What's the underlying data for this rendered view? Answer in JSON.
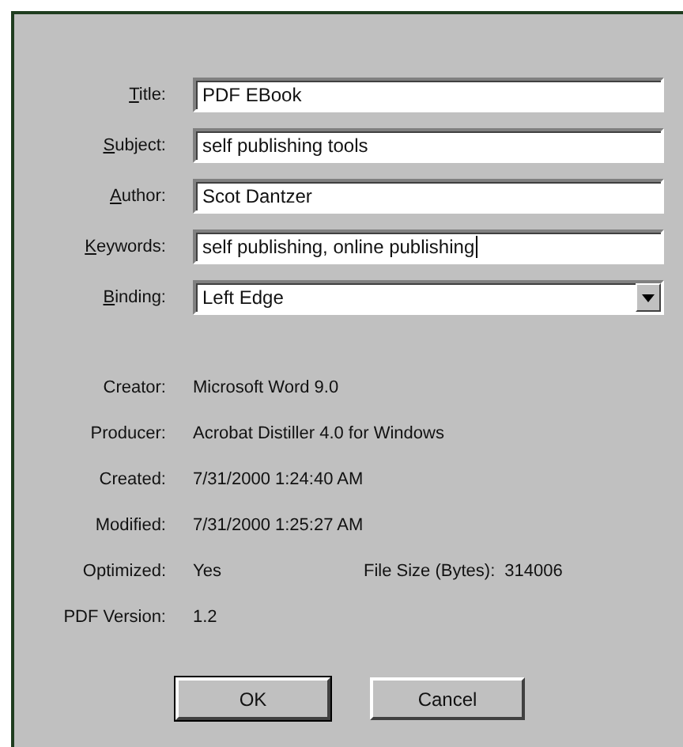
{
  "fields": [
    {
      "label": "Title:",
      "value": "PDF EBook",
      "kind": "text",
      "focused": false
    },
    {
      "label": "Subject:",
      "value": "self publishing tools",
      "kind": "text",
      "focused": false
    },
    {
      "label": "Author:",
      "value": "Scot Dantzer",
      "kind": "text",
      "focused": false
    },
    {
      "label": "Keywords:",
      "value": "self publishing, online publishing",
      "kind": "text",
      "focused": true
    },
    {
      "label": "Binding:",
      "value": "Left Edge",
      "kind": "dropdown",
      "focused": false
    }
  ],
  "info": [
    {
      "label": "Creator:",
      "value": "Microsoft Word 9.0"
    },
    {
      "label": "Producer:",
      "value": "Acrobat Distiller 4.0 for Windows"
    },
    {
      "label": "Created:",
      "value": "7/31/2000 1:24:40 AM"
    },
    {
      "label": "Modified:",
      "value": "7/31/2000 1:25:27 AM"
    },
    {
      "label": "Optimized:",
      "value": "Yes",
      "extra_label": "File Size (Bytes):",
      "extra_value": "314006"
    },
    {
      "label": "PDF Version:",
      "value": "1.2"
    }
  ],
  "buttons": [
    {
      "label": "OK",
      "default": true
    },
    {
      "label": "Cancel",
      "default": false
    }
  ]
}
